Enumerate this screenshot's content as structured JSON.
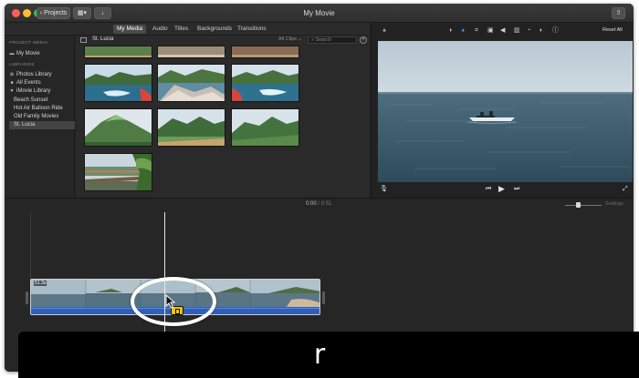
{
  "window": {
    "title": "My Movie",
    "projects_label": "Projects",
    "traffic_colors": [
      "#ff5f57",
      "#febc2e",
      "#28c840"
    ]
  },
  "tabs": [
    {
      "label": "My Media",
      "active": true
    },
    {
      "label": "Audio",
      "active": false
    },
    {
      "label": "Titles",
      "active": false
    },
    {
      "label": "Backgrounds",
      "active": false
    },
    {
      "label": "Transitions",
      "active": false
    }
  ],
  "sidebar": {
    "project_media_header": "PROJECT MEDIA",
    "project_item": "My Movie",
    "libraries_header": "LIBRARIES",
    "items": [
      {
        "label": "Photos Library",
        "icon": "photos-icon"
      },
      {
        "label": "All Events",
        "icon": "events-icon"
      },
      {
        "label": "iMovie Library",
        "icon": "disclosure-triangle-icon"
      },
      {
        "label": "Beach Sunset"
      },
      {
        "label": "Hot Air Balloon Ride"
      },
      {
        "label": "Old Family Movies"
      },
      {
        "label": "St. Lucia",
        "selected": true
      }
    ]
  },
  "browser": {
    "title": "St. Lucia",
    "filter": "All Clips",
    "search_placeholder": "Search",
    "clip_count": 10
  },
  "viewer": {
    "reset_label": "Reset All",
    "tools": [
      "color-balance-icon",
      "color-correction-icon",
      "crop-icon",
      "stabilization-icon",
      "volume-icon",
      "noise-reduction-icon",
      "speed-icon",
      "filter-icon",
      "info-icon"
    ]
  },
  "timeline": {
    "current_time": "0:00",
    "separator": "/",
    "total_time": "0:51",
    "settings_label": "Settings",
    "clip_label": "51.3s"
  },
  "caption": {
    "text": "r"
  }
}
